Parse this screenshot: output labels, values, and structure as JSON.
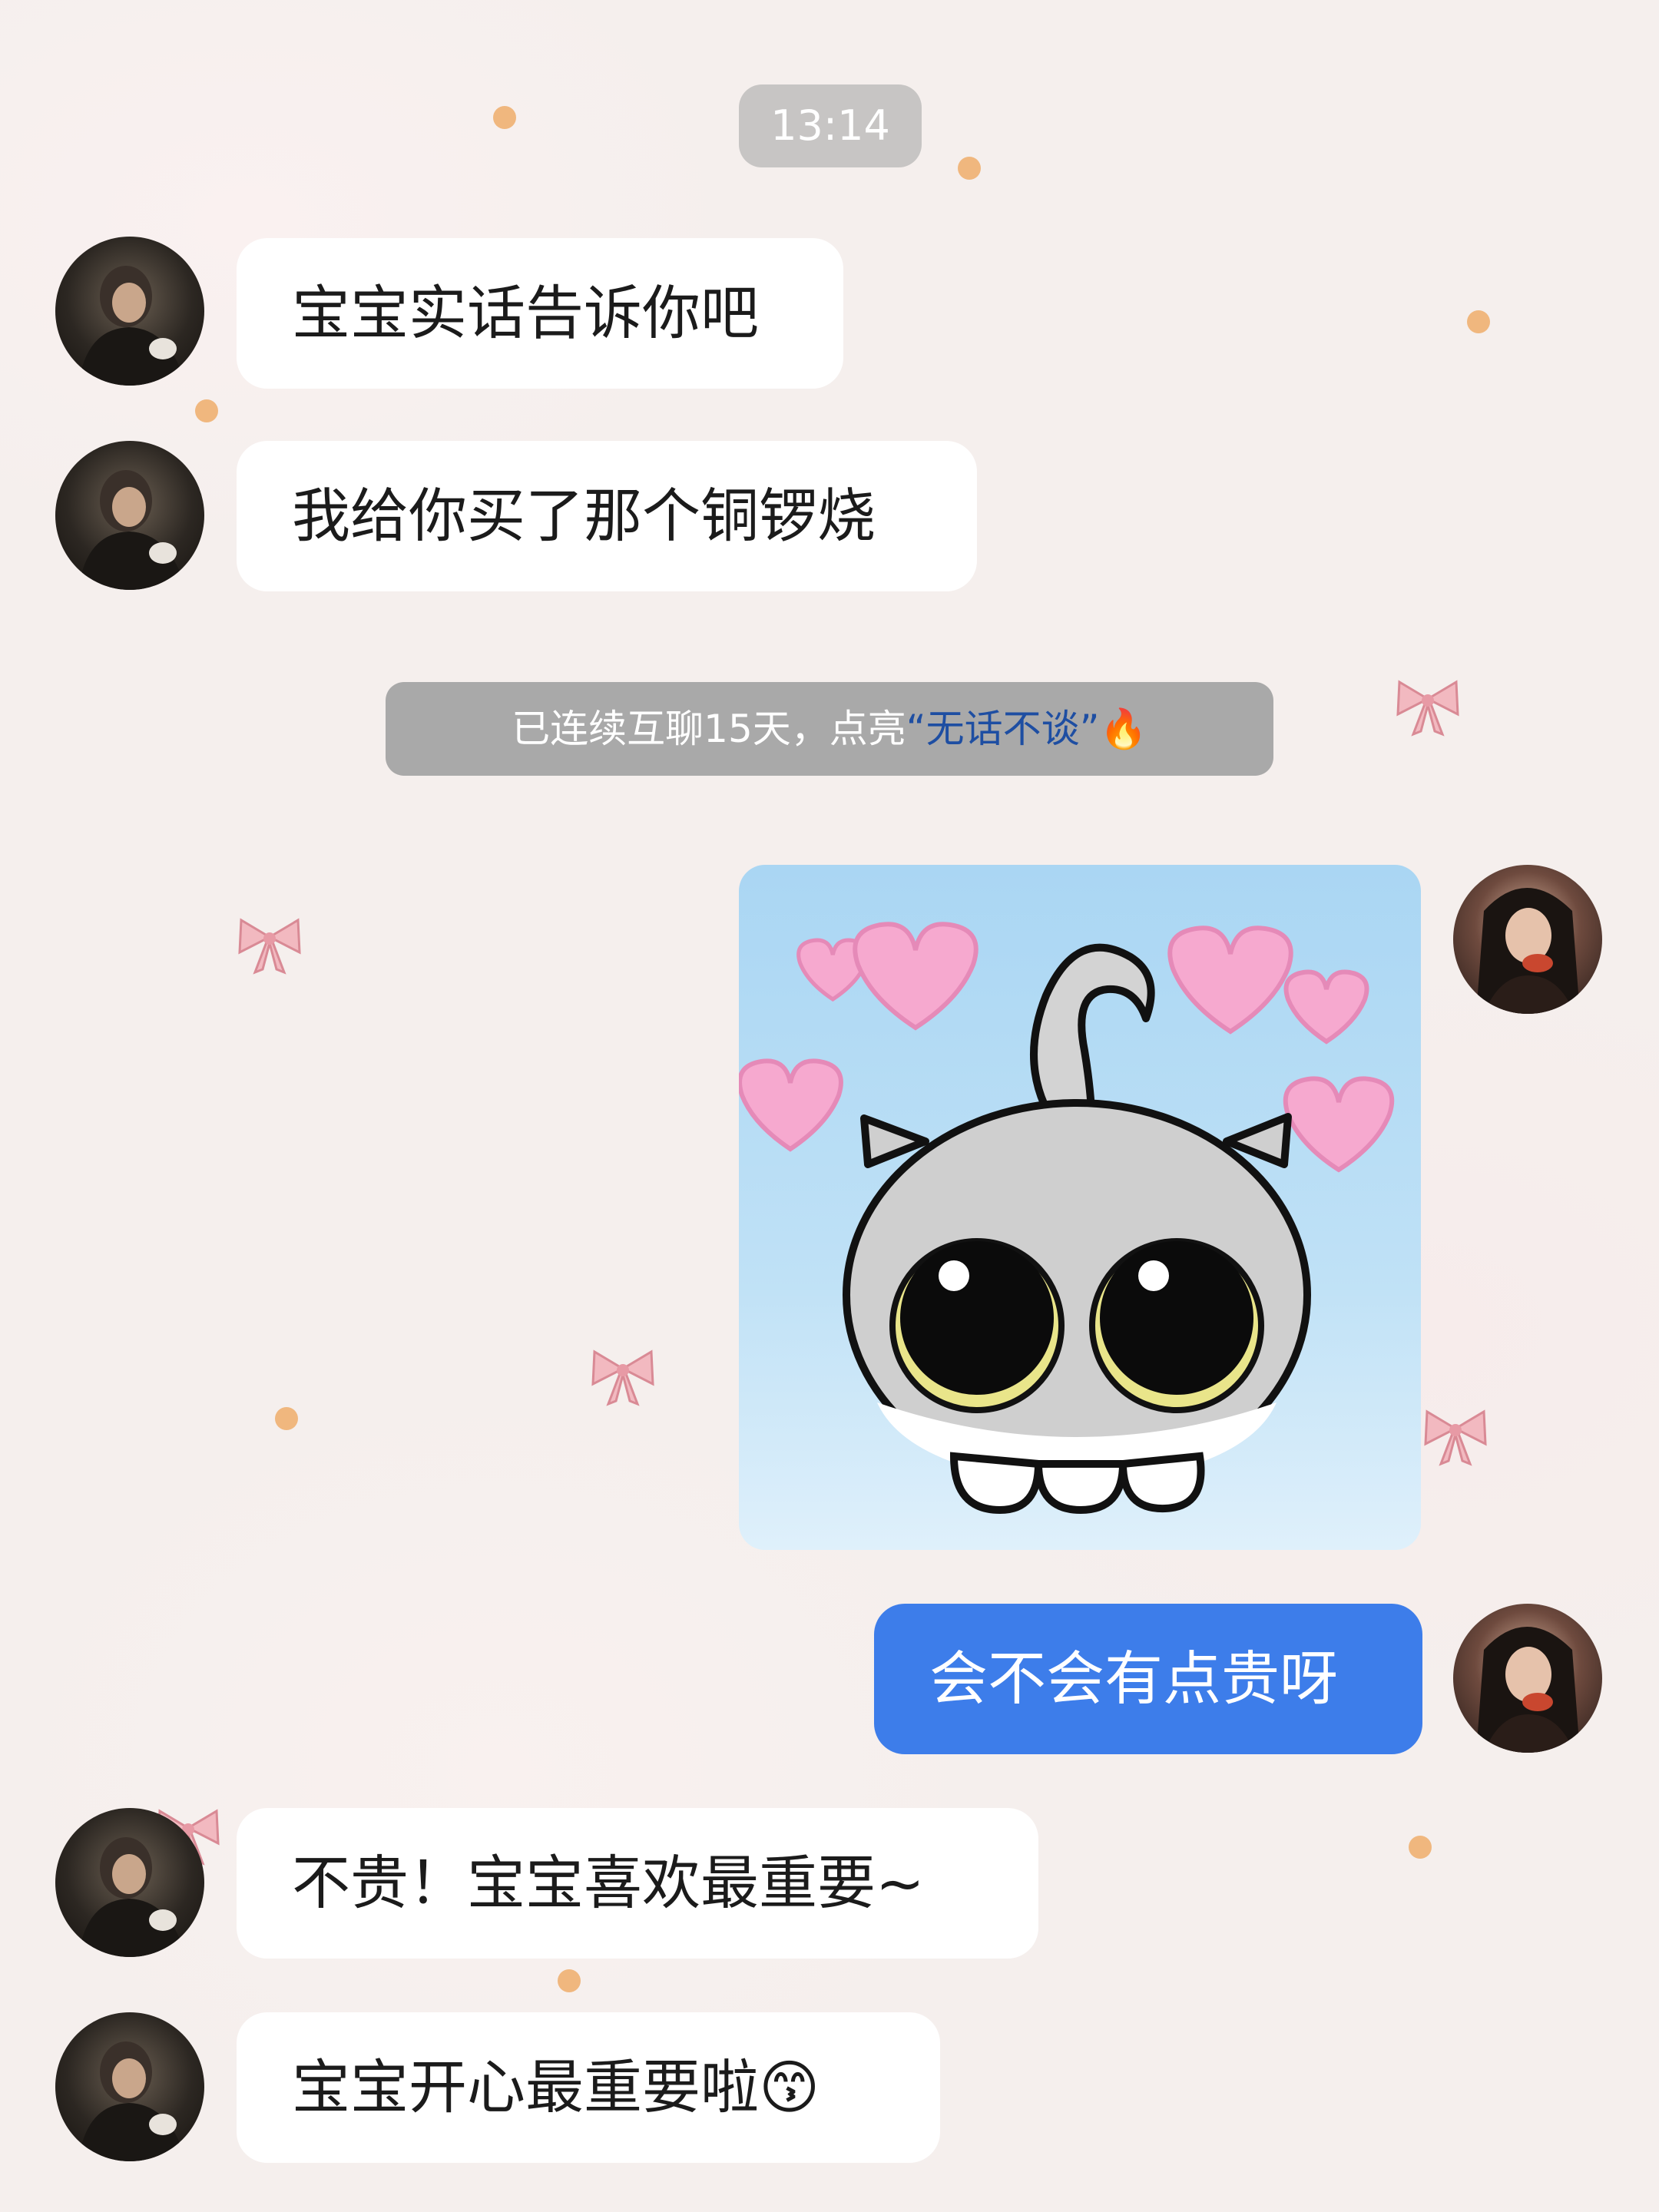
{
  "chat": {
    "timestamp": "13:14",
    "system_notice": {
      "prefix": "已连续互聊15天，点亮",
      "highlight": "“无话不谈”",
      "suffix_emoji": "🔥"
    },
    "messages": [
      {
        "side": "left",
        "text": "宝宝实话告诉你吧"
      },
      {
        "side": "left",
        "text": "我给你买了那个铜锣烧"
      },
      {
        "side": "right",
        "type": "sticker",
        "sticker_icon": "grey-cat-with-hearts-sticker"
      },
      {
        "side": "right",
        "text": "会不会有点贵呀"
      },
      {
        "side": "left",
        "text": "不贵！宝宝喜欢最重要~"
      },
      {
        "side": "left",
        "text": "宝宝开心最重要啦",
        "emoji": "😙"
      }
    ]
  },
  "colors": {
    "sent_bubble": "#3d7dea",
    "received_bubble": "#ffffff",
    "time_pill": "#c7c5c4",
    "system_pill": "#a9a9a9",
    "highlight_text": "#1e4ea2"
  }
}
